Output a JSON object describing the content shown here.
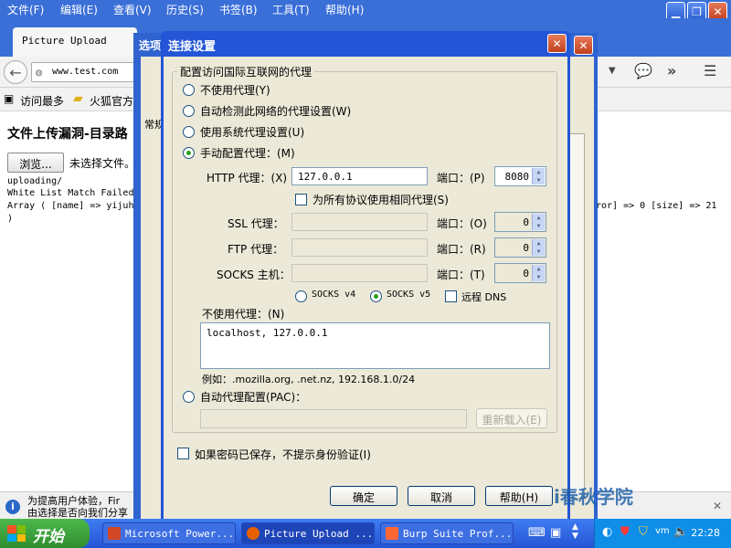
{
  "browser": {
    "menu": [
      "文件(F)",
      "编辑(E)",
      "查看(V)",
      "历史(S)",
      "书签(B)",
      "工具(T)",
      "帮助(H)"
    ],
    "tab_title": "Picture Upload",
    "url": "www.test.com",
    "bookmarks": [
      "访问最多",
      "火狐官方"
    ]
  },
  "page": {
    "title": "文件上传漏洞-目录路",
    "browse_button": "浏览...",
    "no_file": "未选择文件。",
    "line1": "uploading/",
    "line2": "White List Match Failed",
    "line3": "Array ( [name] => yijuh",
    "line3_right": "ror] => 0 [size] => 21",
    "line4": ")",
    "notice_line1": "为提高用户体验，Fir",
    "notice_line2": "由选择是否向我们分享"
  },
  "options_window": {
    "title": "选项",
    "tab": "常规"
  },
  "dialog": {
    "title": "连接设置",
    "group_label": "配置访问国际互联网的代理",
    "radio_no_proxy": "不使用代理(Y)",
    "radio_auto_detect": "自动检测此网络的代理设置(W)",
    "radio_system": "使用系统代理设置(U)",
    "radio_manual": "手动配置代理：(M)",
    "http_label": "HTTP 代理：(X)",
    "http_value": "127.0.0.1",
    "http_port_label": "端口：(P)",
    "http_port": "8080",
    "same_proxy_label": "为所有协议使用相同代理(S)",
    "ssl_label": "SSL 代理：",
    "ssl_value": "",
    "ssl_port_label": "端口：(O)",
    "ssl_port": "0",
    "ftp_label": "FTP 代理：",
    "ftp_value": "",
    "ftp_port_label": "端口：(R)",
    "ftp_port": "0",
    "socks_label": "SOCKS 主机：",
    "socks_value": "",
    "socks_port_label": "端口：(T)",
    "socks_port": "0",
    "socks_v4": "SOCKS v4",
    "socks_v5": "SOCKS v5",
    "remote_dns": "远程 DNS",
    "no_proxy_label": "不使用代理：(N)",
    "no_proxy_value": "localhost, 127.0.0.1",
    "example": "例如：.mozilla.org, .net.nz, 192.168.1.0/24",
    "radio_pac": "自动代理配置(PAC)：",
    "reload_button": "重新载入(E)",
    "no_prompt_label": "如果密码已保存，不提示身份验证(I)",
    "ok_button": "确定",
    "cancel_button": "取消",
    "help_button": "帮助(H)"
  },
  "taskbar": {
    "start": "开始",
    "tasks": [
      "Microsoft Power...",
      "Picture Upload ...",
      "Burp Suite Prof..."
    ],
    "clock": "22:28"
  },
  "watermark": "i春秋学院",
  "colors": {
    "titlebar": "#2455d6",
    "dialog_bg": "#ece9d8",
    "taskbar": "#2454d5",
    "start_green": "#3aa33a",
    "radio_dot": "#21a121"
  }
}
